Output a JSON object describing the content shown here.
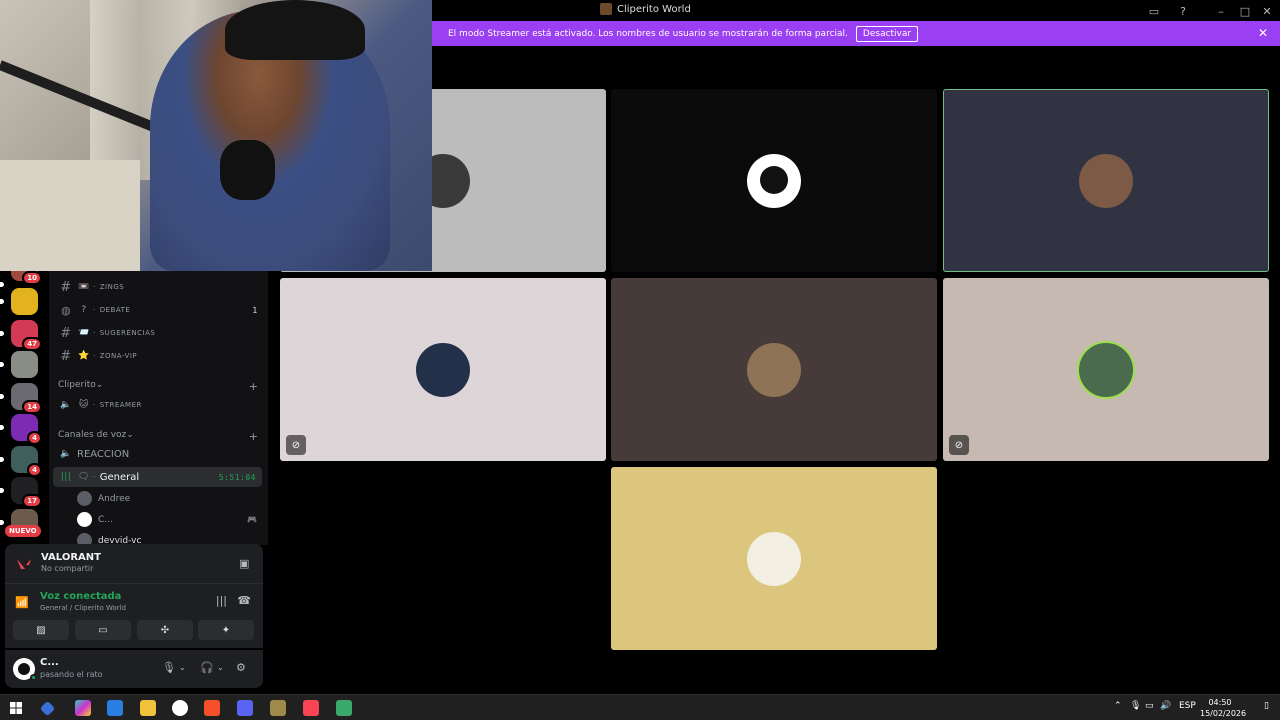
{
  "window": {
    "title": "Cliperito World",
    "controls": [
      "minimize",
      "maximize",
      "close"
    ]
  },
  "banner": {
    "message": "El modo Streamer está activado. Los nombres de usuario se mostrarán de forma parcial.",
    "button_label": "Desactivar"
  },
  "servers": [
    {
      "name": "server-1",
      "badge": "10",
      "color": "#a04a3f"
    },
    {
      "name": "server-j",
      "badge": "",
      "color": "#e3b21f"
    },
    {
      "name": "server-3",
      "badge": "47",
      "color": "#d33a55"
    },
    {
      "name": "server-4",
      "badge": "",
      "color": "#8a8c86"
    },
    {
      "name": "server-twitch",
      "badge": "14",
      "color": "#6a6a70"
    },
    {
      "name": "server-6",
      "badge": "4",
      "color": "#7c2bb3"
    },
    {
      "name": "server-prime",
      "badge": "4",
      "color": "#3f5f5a"
    },
    {
      "name": "server-8",
      "badge": "17",
      "color": "#202022"
    },
    {
      "name": "server-9",
      "badge": "",
      "color": "#6c5a4c"
    }
  ],
  "nuevo_label": "NUEVO",
  "channels": {
    "text": [
      {
        "emoji": "📼",
        "name": "ZINGS",
        "count": ""
      },
      {
        "emoji": "?",
        "name": "DEBATE",
        "count": "1"
      },
      {
        "emoji": "📨",
        "name": "SUGERENCIAS",
        "count": ""
      },
      {
        "emoji": "⭐",
        "name": "ZONA-VIP",
        "count": ""
      }
    ],
    "category_cliperito": "Cliperito",
    "streamer_channel": {
      "emoji": "🐱",
      "name": "STREAMER"
    },
    "category_voice": "Canales de voz",
    "reaccion_label": "REACCION",
    "general_label": "General",
    "general_time": "5:51:04",
    "members": [
      {
        "name": "Andree"
      },
      {
        "name": "C..."
      },
      {
        "name": "devvid-vc"
      }
    ]
  },
  "activity": {
    "game": "VALORANT",
    "sub": "No compartir"
  },
  "voice": {
    "status": "Voz conectada",
    "location": "General / Cliperito World"
  },
  "user": {
    "name": "C...",
    "status": "pasando el rato"
  },
  "tiles": [
    {
      "name": "tile-1",
      "bg": "#bcbcbc",
      "avatar": "#3a3a3a",
      "muted": false,
      "speaking": false
    },
    {
      "name": "tile-2",
      "bg": "#0b0b0b",
      "avatar": "#ffffff",
      "muted": false,
      "speaking": false
    },
    {
      "name": "tile-3",
      "bg": "#313343",
      "avatar": "#7c5a45",
      "muted": false,
      "speaking": true
    },
    {
      "name": "tile-4",
      "bg": "#ddd5d8",
      "avatar": "#22304a",
      "muted": true,
      "speaking": false
    },
    {
      "name": "tile-5",
      "bg": "#463b38",
      "avatar": "#8e7356",
      "muted": false,
      "speaking": false
    },
    {
      "name": "tile-6",
      "bg": "#c6b9b2",
      "avatar": "#4a6b4e",
      "muted": true,
      "speaking": false
    },
    {
      "name": "tile-7",
      "bg": "#dcc67e",
      "avatar": "#f4efe3",
      "muted": false,
      "speaking": false
    }
  ],
  "taskbar": {
    "lang": "ESP",
    "time": "04:50",
    "date": "15/02/2026"
  },
  "colors": {
    "accent": "#9b3ff2",
    "online": "#23a55a",
    "badge": "#e23d44"
  }
}
